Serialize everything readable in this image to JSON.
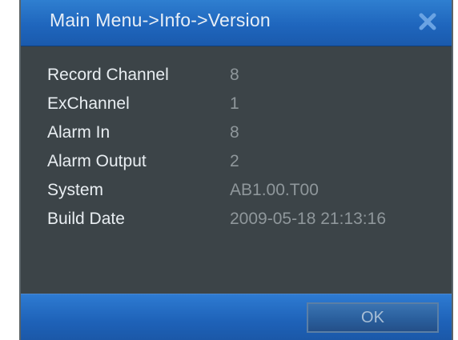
{
  "window": {
    "title": "Main Menu->Info->Version",
    "close_icon": "close-icon"
  },
  "info_rows": [
    {
      "label": "Record Channel",
      "value": "8"
    },
    {
      "label": "ExChannel",
      "value": "1"
    },
    {
      "label": "Alarm In",
      "value": "8"
    },
    {
      "label": "Alarm Output",
      "value": "2"
    },
    {
      "label": "System",
      "value": "AB1.00.T00"
    },
    {
      "label": "Build Date",
      "value": "2009-05-18 21:13:16"
    }
  ],
  "footer": {
    "ok_label": "OK"
  },
  "colors": {
    "title_bar": "#1f66bd",
    "panel_bg": "#3c4448",
    "label_text": "#e9eef2",
    "value_text": "#8f979b"
  }
}
